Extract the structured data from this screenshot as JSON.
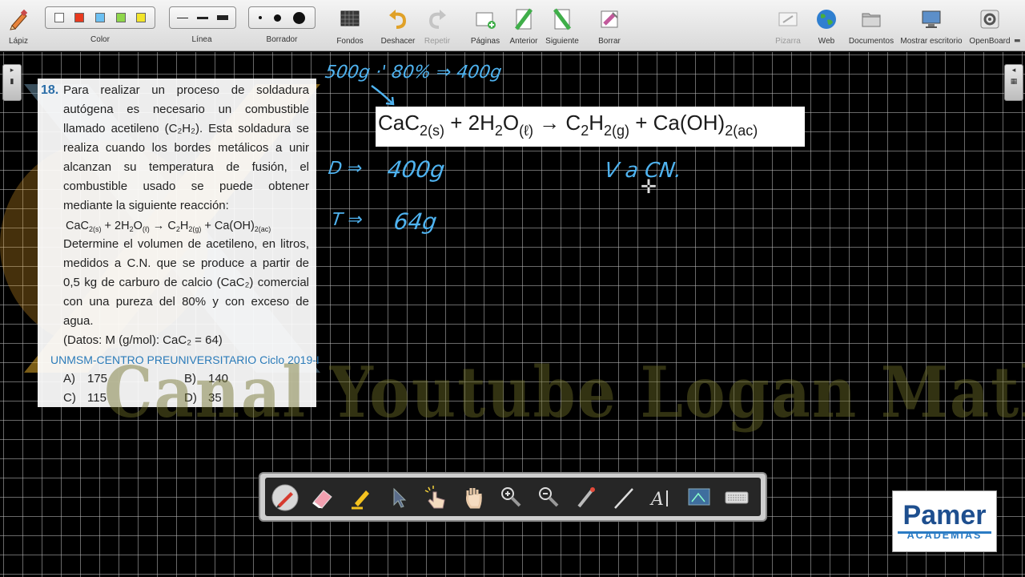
{
  "toolbar": {
    "lapiz": "Lápiz",
    "color": "Color",
    "linea": "Línea",
    "borrador": "Borrador",
    "fondos": "Fondos",
    "deshacer": "Deshacer",
    "repetir": "Repetir",
    "paginas": "Páginas",
    "anterior": "Anterior",
    "siguiente": "Siguiente",
    "borrar": "Borrar",
    "pizarra": "Pizarra",
    "web": "Web",
    "documentos": "Documentos",
    "mostrar_escritorio": "Mostrar escritorio",
    "openboard": "OpenBoard",
    "colors": [
      "#ffffff",
      "#e8391e",
      "#6cc0f2",
      "#8fd64a",
      "#f2e52a"
    ]
  },
  "problem": {
    "number": "18.",
    "text1": "Para realizar un proceso de soldadura autógena es necesario un combustible llamado acetileno (C₂H₂). Esta soldadura se realiza cuando los bordes metálicos a unir alcanzan su temperatura de fusión, el combustible usado se puede obtener mediante la siguiente reacción:",
    "equation": "CaC2(s) + 2H2O(ℓ) → C2H2(g) + Ca(OH)2(ac)",
    "text2": "Determine el volumen de acetileno, en litros, medidos a C.N. que se produce a partir de 0,5 kg de carburo de calcio (CaC₂) comercial con una pureza del 80% y con exceso de agua.",
    "datos": "(Datos: M (g/mol): CaC₂ = 64)",
    "source": "UNMSM-CENTRO PREUNIVERSITARIO Ciclo 2019-I",
    "options": [
      {
        "letter": "A)",
        "value": "175"
      },
      {
        "letter": "B)",
        "value": "140"
      },
      {
        "letter": "C)",
        "value": "115"
      },
      {
        "letter": "D)",
        "value": "35"
      }
    ]
  },
  "board": {
    "equation_box": "CaC2(s) + 2H2O(ℓ) → C2H2(g) + Ca(OH)2(ac)",
    "handwriting": {
      "line1": "500g ·' 80% ⇒ 400g",
      "line2_label": "D ⇒",
      "line2_value": "400g",
      "line3_label": "T ⇒",
      "line3_value": "64g",
      "note": "V a CN."
    },
    "watermark": "Canal Youtube Logan Maths"
  },
  "logo": {
    "name": "Pamer",
    "sub": "ACADEMIAS"
  }
}
